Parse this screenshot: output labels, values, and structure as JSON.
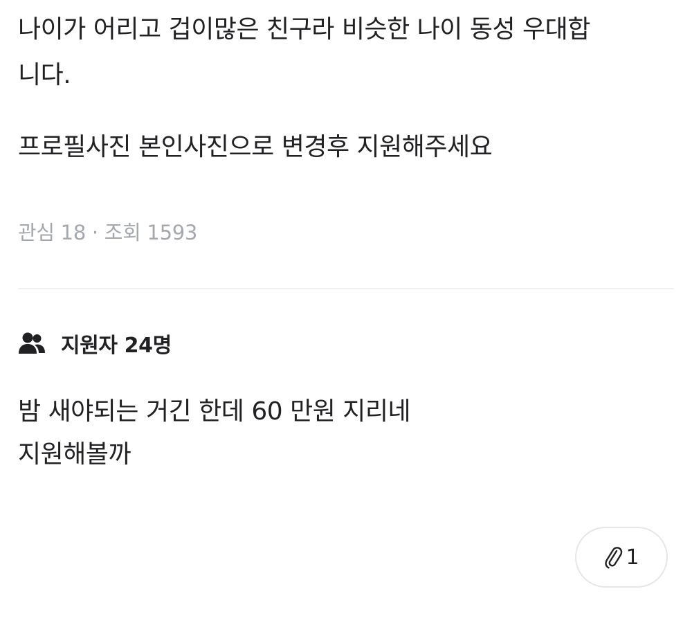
{
  "post": {
    "lines": [
      "나이가 어리고 겁이많은 친구라 비슷한 나이 동성 우대합",
      "니다.",
      "프로필사진 본인사진으로 변경후 지원해주세요"
    ],
    "meta": "관심 18 · 조회 1593"
  },
  "applicants": {
    "icon": "people-icon",
    "label": "지원자 24명"
  },
  "comment": {
    "lines": [
      "밤 새야되는 거긴 한데 60 만원 지리네",
      "지원해볼까"
    ]
  },
  "attachment_button": {
    "icon": "paperclip-icon",
    "count": "1"
  }
}
